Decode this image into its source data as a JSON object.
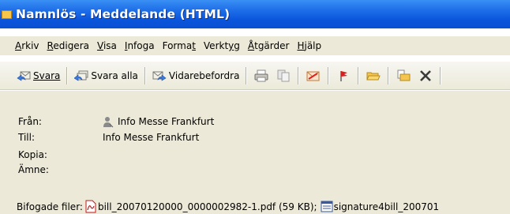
{
  "window": {
    "title": "Namnlös - Meddelande (HTML)"
  },
  "menu": {
    "items": [
      {
        "label": "Arkiv"
      },
      {
        "label": "Redigera"
      },
      {
        "label": "Visa"
      },
      {
        "label": "Infoga"
      },
      {
        "label": "Format"
      },
      {
        "label": "Verktyg"
      },
      {
        "label": "Åtgärder"
      },
      {
        "label": "Hjälp"
      }
    ]
  },
  "toolbar": {
    "reply_label": "Svara",
    "reply_all_label": "Svara alla",
    "forward_label": "Vidarebefordra"
  },
  "header": {
    "from_label": "Från:",
    "from_value": "Info Messe Frankfurt",
    "to_label": "Till:",
    "to_value": "Info Messe Frankfurt",
    "cc_label": "Kopia:",
    "subject_label": "Ämne:",
    "attachments_label": "Bifogade filer:",
    "attachment1": "bill_20070120000_0000002982-1.pdf (59 KB);",
    "attachment2": "signature4bill_200701"
  },
  "icons": {
    "title": "envelope-icon",
    "reply": "reply-icon",
    "reply_all": "reply-all-icon",
    "forward": "forward-icon",
    "print": "printer-icon",
    "copy": "copy-icon",
    "delete_flag": "mark-icon",
    "follow_up": "flag-icon",
    "open_folder": "folder-icon",
    "move": "move-to-folder-icon",
    "delete": "delete-icon",
    "sender": "person-icon",
    "pdf": "pdf-icon",
    "sig": "signature-file-icon"
  },
  "colors": {
    "titlebar": "#0a55db",
    "chrome": "#ece9d8"
  }
}
